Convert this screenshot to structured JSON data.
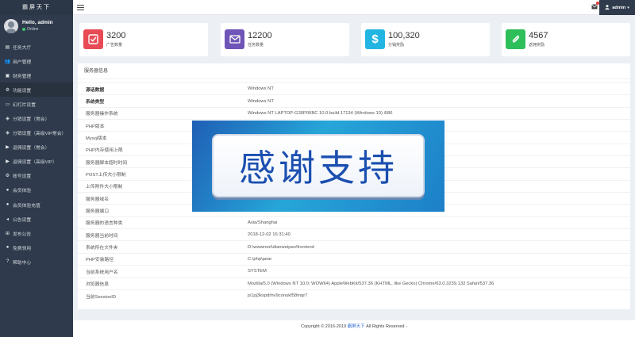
{
  "brand": "霸屏天下",
  "user": {
    "name": "Hello, admin",
    "status": "Online"
  },
  "menu": [
    {
      "label": "任务大厅",
      "icon": "list-icon"
    },
    {
      "label": "用户管理",
      "icon": "users-icon"
    },
    {
      "label": "财务管理",
      "icon": "money-icon"
    },
    {
      "label": "功能设置",
      "icon": "cogs-icon"
    },
    {
      "label": "幻灯片设置",
      "icon": "slides-icon"
    },
    {
      "label": "分销设置（常会）",
      "icon": "share-icon"
    },
    {
      "label": "分销设置（高级VIP常会）",
      "icon": "share-icon"
    },
    {
      "label": "返佣设置（常会）",
      "icon": "video-icon"
    },
    {
      "label": "返佣设置（高级VIP）",
      "icon": "video-icon"
    },
    {
      "label": "账号设置",
      "icon": "gear-icon"
    },
    {
      "label": "会员体验",
      "icon": "circle-icon"
    },
    {
      "label": "会员体验充值",
      "icon": "circle-icon"
    },
    {
      "label": "公告设置",
      "icon": "megaphone-icon"
    },
    {
      "label": "发布公告",
      "icon": "plus-square-icon"
    },
    {
      "label": "免费领用",
      "icon": "circle-icon"
    },
    {
      "label": "帮助中心",
      "icon": "help-icon"
    }
  ],
  "topbar": {
    "admin_label": "admin"
  },
  "stats": [
    {
      "value": "3200",
      "label": "广告数量",
      "color": "#e84b55",
      "icon": "check-square-icon"
    },
    {
      "value": "12200",
      "label": "任务数量",
      "color": "#6f55b8",
      "icon": "envelope-icon"
    },
    {
      "value": "100,320",
      "label": "分销奖励",
      "color": "#23b5e2",
      "icon": "dollar-icon"
    },
    {
      "value": "4567",
      "label": "返佣奖励",
      "color": "#2fbf5a",
      "icon": "paperclip-icon"
    }
  ],
  "panel": {
    "title": "服务器信息",
    "rows": [
      {
        "key": "源话数据",
        "value": "Windows NT"
      },
      {
        "key": "系统类型",
        "value": "Windows NT"
      },
      {
        "key": "服务器操作系统",
        "value": "Windows NT LAPTOP-G30P06BC 10.0 build 17134 (Windows 10) i586"
      },
      {
        "key": "PHP版本",
        "value": ""
      },
      {
        "key": "Mysql版本",
        "value": ""
      },
      {
        "key": "PHP内存使用上限",
        "value": ""
      },
      {
        "key": "服务器脚本超时时间",
        "value": ""
      },
      {
        "key": "POST上传大小限制",
        "value": ""
      },
      {
        "key": "上传附件大小限制",
        "value": ""
      },
      {
        "key": "服务器域名",
        "value": ""
      },
      {
        "key": "服务器端口",
        "value": ""
      },
      {
        "key": "服务器的语言种类",
        "value": "Asia/Shanghai"
      },
      {
        "key": "服务器当前时间",
        "value": "2018-12-02 16:31:40"
      },
      {
        "key": "系统所在文件夹",
        "value": "D:\\wwwroot\\dianweipan\\frontend"
      },
      {
        "key": "PHP安装路径",
        "value": "C:\\php\\pear"
      },
      {
        "key": "当前系统用户名",
        "value": "SYSTEM"
      },
      {
        "key": "浏览器信息",
        "value": "Mozilla/5.0 (Windows NT 10.0; WOW64) AppleWebKit/537.36 (KHTML, like Gecko) Chrome/63.0.3239.132 Safari/537.36"
      },
      {
        "key": "当前SessionID",
        "value": "js1pj3kspdrhv9conukf58mqr7"
      }
    ]
  },
  "overlay_text": "感谢支持",
  "footer": {
    "prefix": "Copyright © 2016-2019 ",
    "link": "霸屏天下",
    "suffix": " All Rights Reserved -"
  }
}
